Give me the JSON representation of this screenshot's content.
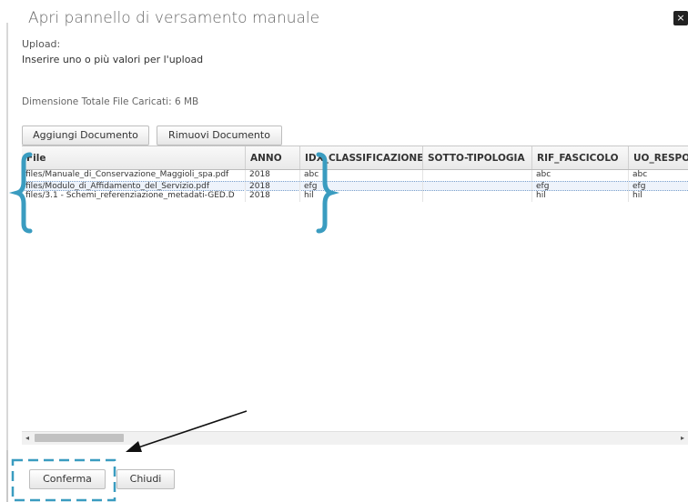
{
  "dialog": {
    "title": "Apri pannello di versamento manuale",
    "close_glyph": "×",
    "upload_label": "Upload:",
    "upload_hint": "Inserire uno o più valori per l'upload",
    "total_size": "Dimensione Totale File Caricati: 6 MB"
  },
  "toolbar": {
    "add_label": "Aggiungi Documento",
    "remove_label": "Rimuovi Documento"
  },
  "table": {
    "columns": [
      "File",
      "ANNO",
      "IDX_CLASSIFICAZIONE",
      "SOTTO-TIPOLOGIA",
      "RIF_FASCICOLO",
      "UO_RESPON"
    ],
    "rows": [
      [
        "files/Manuale_di_Conservazione_Maggioli_spa.pdf",
        "2018",
        "abc",
        "",
        "abc",
        "abc"
      ],
      [
        "files/Modulo_di_Affidamento_del_Servizio.pdf",
        "2018",
        "efg",
        "",
        "efg",
        "efg"
      ],
      [
        "files/3.1 - Schemi_referenziazione_metadati-GED.D",
        "2018",
        "hil",
        "",
        "hil",
        "hil"
      ]
    ],
    "selected_row": 1
  },
  "scrollbar": {
    "left_arrow": "◂",
    "right_arrow": "▸"
  },
  "footer": {
    "confirm_label": "Conferma",
    "close_label": "Chiudi"
  },
  "annotation_colors": {
    "brace": "#3a9cc0",
    "dashed_box": "#3a9cc0",
    "arrow": "#111111"
  }
}
